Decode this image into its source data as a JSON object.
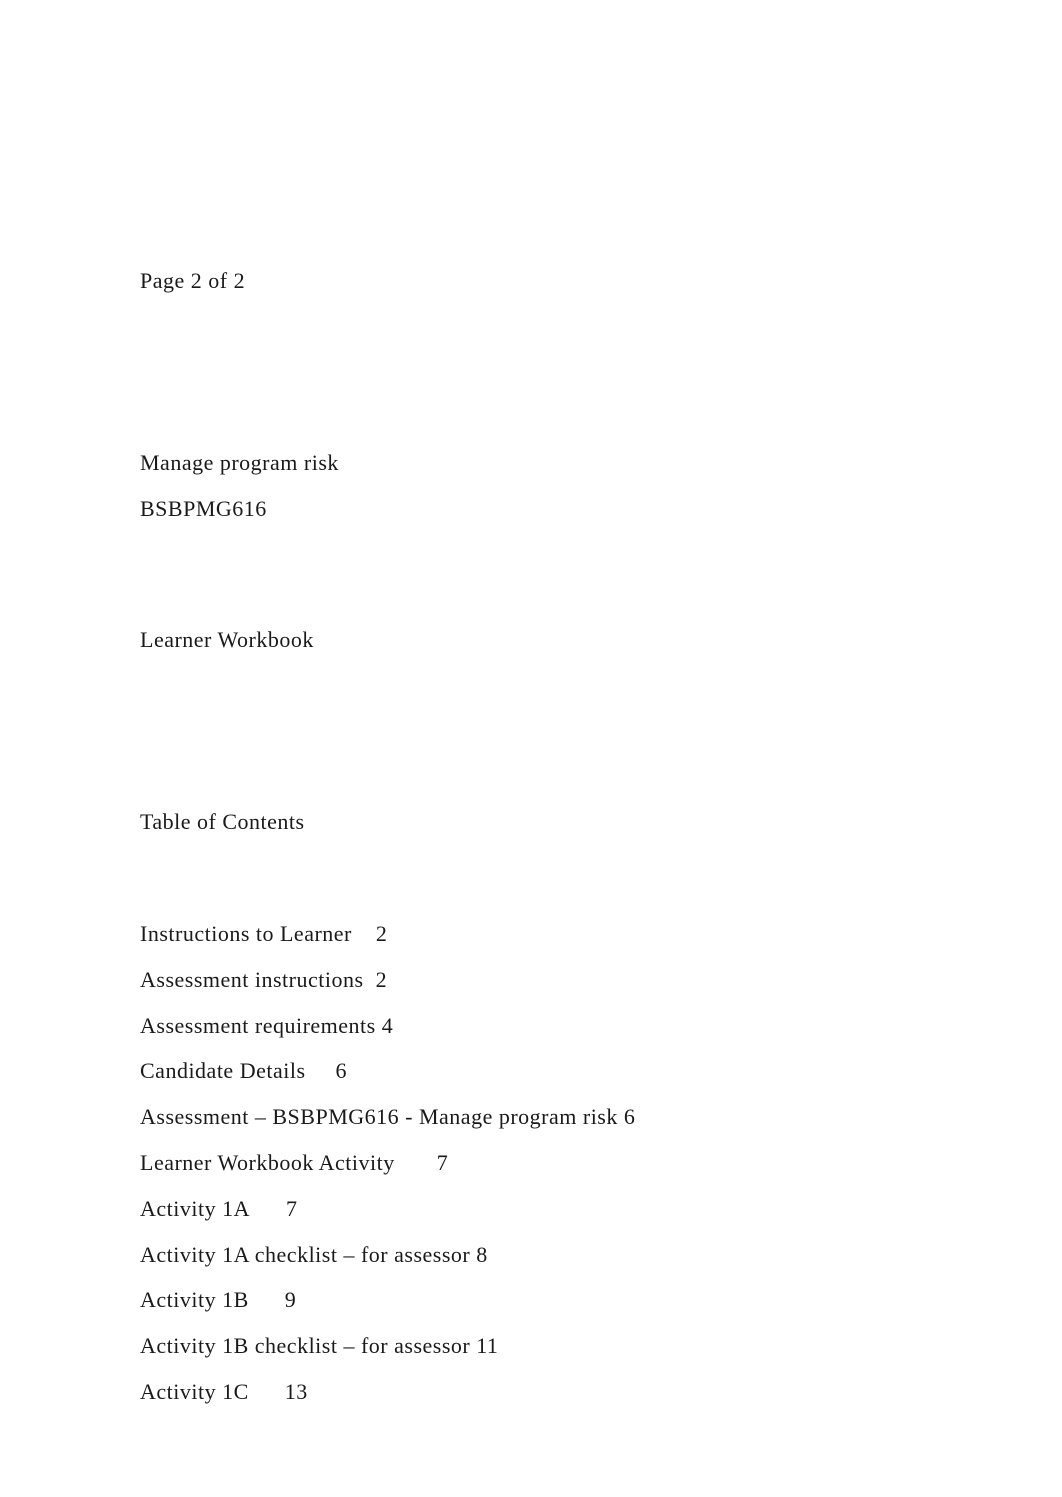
{
  "page_info": "Page 2 of 2",
  "document": {
    "title": "Manage program risk",
    "code": "BSBPMG616",
    "subtitle": "Learner Workbook"
  },
  "toc": {
    "heading": "Table of Contents",
    "entries": [
      {
        "label": "Instructions to Learner",
        "page": "2"
      },
      {
        "label": "Assessment instructions",
        "page": "2"
      },
      {
        "label": "Assessment requirements",
        "page": "4"
      },
      {
        "label": "Candidate Details",
        "page": "6"
      },
      {
        "label": "Assessment – BSBPMG616 - Manage program risk",
        "page": "6"
      },
      {
        "label": "Learner Workbook Activity",
        "page": "7"
      },
      {
        "label": "Activity 1A",
        "page": "7"
      },
      {
        "label": "Activity 1A checklist – for assessor",
        "page": "8"
      },
      {
        "label": "Activity 1B",
        "page": "9"
      },
      {
        "label": "Activity 1B checklist – for assessor",
        "page": "11"
      },
      {
        "label": "Activity 1C",
        "page": "13"
      }
    ]
  }
}
